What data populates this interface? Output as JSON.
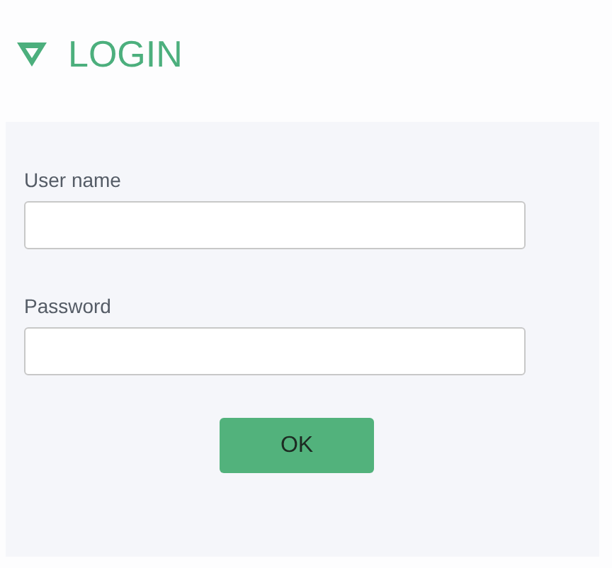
{
  "header": {
    "title": "LOGIN"
  },
  "fields": [
    {
      "label": "User name"
    },
    {
      "label": "Password"
    }
  ],
  "buttons": [
    "OK"
  ]
}
